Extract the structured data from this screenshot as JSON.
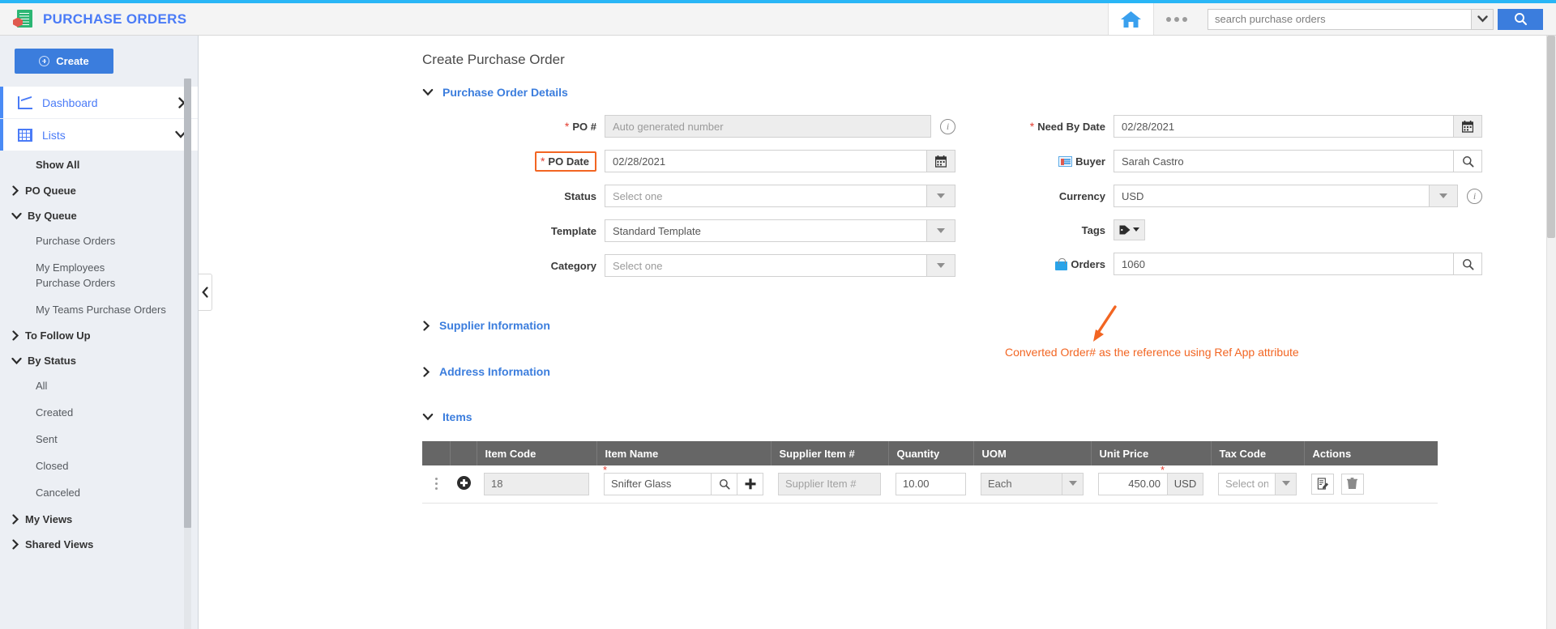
{
  "header": {
    "brand_title": "PURCHASE ORDERS",
    "brand_icon": "document-cube-icon",
    "home_icon": "home-icon",
    "more_icon": "more-options-icon",
    "search_placeholder": "search purchase orders",
    "search_value": "",
    "search_dropdown_icon": "chevron-down-icon",
    "search_button_icon": "search-icon",
    "accent_color": "#29b6f6"
  },
  "sidebar": {
    "create_label": "Create",
    "main_items": [
      {
        "label": "Dashboard",
        "icon": "chart-icon",
        "chevron": "chevron-right-icon"
      },
      {
        "label": "Lists",
        "icon": "grid-icon",
        "chevron": "chevron-down-icon"
      }
    ],
    "show_all": "Show All",
    "groups": [
      {
        "label": "PO Queue",
        "expanded": false,
        "children": []
      },
      {
        "label": "By Queue",
        "expanded": true,
        "children": [
          "Purchase Orders",
          "My Employees Purchase Orders",
          "My Teams Purchase Orders"
        ]
      },
      {
        "label": "To Follow Up",
        "expanded": false,
        "children": []
      },
      {
        "label": "By Status",
        "expanded": true,
        "children": [
          "All",
          "Created",
          "Sent",
          "Closed",
          "Canceled"
        ]
      },
      {
        "label": "My Views",
        "expanded": false,
        "children": []
      },
      {
        "label": "Shared Views",
        "expanded": false,
        "children": []
      }
    ]
  },
  "main": {
    "page_title": "Create Purchase Order",
    "sections": {
      "po_details": {
        "label": "Purchase Order Details",
        "expanded": true
      },
      "supplier_info": {
        "label": "Supplier Information",
        "expanded": false
      },
      "address_info": {
        "label": "Address Information",
        "expanded": false
      },
      "items": {
        "label": "Items",
        "expanded": true
      }
    },
    "fields_left": {
      "po_number": {
        "label": "PO #",
        "required": true,
        "placeholder": "Auto generated number",
        "value": "",
        "readonly": true,
        "info_icon": "info-icon"
      },
      "po_date": {
        "label": "PO Date",
        "required": true,
        "value": "02/28/2021",
        "addon_icon": "calendar-icon",
        "highlighted": true
      },
      "status": {
        "label": "Status",
        "required": false,
        "placeholder": "Select one",
        "value": "",
        "addon_icon": "caret-down-icon"
      },
      "template": {
        "label": "Template",
        "required": false,
        "value": "Standard Template",
        "addon_icon": "caret-down-icon"
      },
      "category": {
        "label": "Category",
        "required": false,
        "placeholder": "Select one",
        "value": "",
        "addon_icon": "caret-down-icon"
      }
    },
    "fields_right": {
      "need_by_date": {
        "label": "Need By Date",
        "required": true,
        "value": "02/28/2021",
        "addon_icon": "calendar-icon"
      },
      "buyer": {
        "label": "Buyer",
        "required": false,
        "value": "Sarah Castro",
        "label_icon": "id-card-icon",
        "addon_icon": "search-icon"
      },
      "currency": {
        "label": "Currency",
        "required": false,
        "value": "USD",
        "addon_icon": "caret-down-icon",
        "info_icon": "info-icon"
      },
      "tags": {
        "label": "Tags",
        "button_icon": "tag-icon",
        "caret_icon": "caret-down-icon"
      },
      "orders": {
        "label": "Orders",
        "required": false,
        "value": "1060",
        "label_icon": "shopping-bag-icon",
        "addon_icon": "search-icon"
      }
    },
    "annotation": {
      "text": "Converted Order# as the reference using Ref App attribute",
      "color": "#f26522",
      "arrow_icon": "arrow-up-right-icon"
    },
    "items_table": {
      "columns": [
        "",
        "",
        "Item Code",
        "Item Name",
        "Supplier Item #",
        "Quantity",
        "UOM",
        "Unit Price",
        "Tax Code",
        "Actions"
      ],
      "rows": [
        {
          "drag_icon": "kebab-menu-icon",
          "add_icon": "add-row-icon",
          "item_code": {
            "value": "18",
            "readonly": true
          },
          "item_name": {
            "value": "Snifter Glass",
            "required": true,
            "search_icon": "search-icon",
            "add_icon": "plus-icon"
          },
          "supplier_item": {
            "value": "",
            "placeholder": "Supplier Item #",
            "readonly": true
          },
          "quantity": {
            "value": "10.00"
          },
          "uom": {
            "value": "Each",
            "caret_icon": "caret-down-icon"
          },
          "unit_price": {
            "value": "450.00",
            "currency": "USD",
            "required": true
          },
          "tax_code": {
            "value": "",
            "placeholder": "Select one",
            "caret_icon": "caret-down-icon"
          },
          "actions": [
            {
              "icon": "edit-note-icon"
            },
            {
              "icon": "trash-icon"
            }
          ]
        }
      ]
    }
  }
}
